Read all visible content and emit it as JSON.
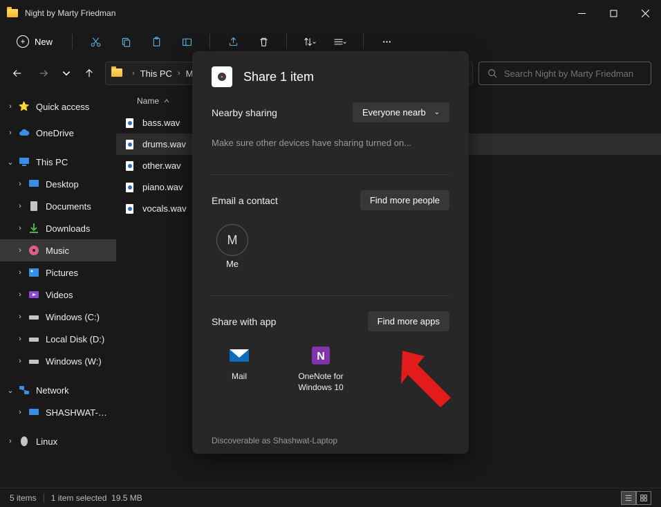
{
  "titlebar": {
    "title": "Night by Marty Friedman"
  },
  "toolbar": {
    "new_label": "New"
  },
  "breadcrumb": [
    "This PC",
    "Music"
  ],
  "search": {
    "placeholder": "Search Night by Marty Friedman"
  },
  "sidebar": {
    "quick_access": "Quick access",
    "onedrive": "OneDrive",
    "this_pc": "This PC",
    "desktop": "Desktop",
    "documents": "Documents",
    "downloads": "Downloads",
    "music": "Music",
    "pictures": "Pictures",
    "videos": "Videos",
    "windows_c": "Windows (C:)",
    "local_d": "Local Disk (D:)",
    "windows_w": "Windows (W:)",
    "network": "Network",
    "shashwat": "SHASHWAT-LAPTOP",
    "linux": "Linux"
  },
  "columns": {
    "name": "Name"
  },
  "files": {
    "bass": "bass.wav",
    "drums": "drums.wav",
    "other": "other.wav",
    "piano": "piano.wav",
    "vocals": "vocals.wav"
  },
  "status": {
    "count": "5 items",
    "selected": "1 item selected",
    "size": "19.5 MB"
  },
  "share": {
    "title": "Share 1 item",
    "nearby_label": "Nearby sharing",
    "nearby_btn": "Everyone nearb",
    "nearby_hint": "Make sure other devices have sharing turned on...",
    "email_label": "Email a contact",
    "find_people": "Find more people",
    "contact_initial": "M",
    "contact_name": "Me",
    "apps_label": "Share with app",
    "find_apps": "Find more apps",
    "mail": "Mail",
    "onenote": "OneNote for Windows 10",
    "discoverable": "Discoverable as Shashwat-Laptop"
  }
}
